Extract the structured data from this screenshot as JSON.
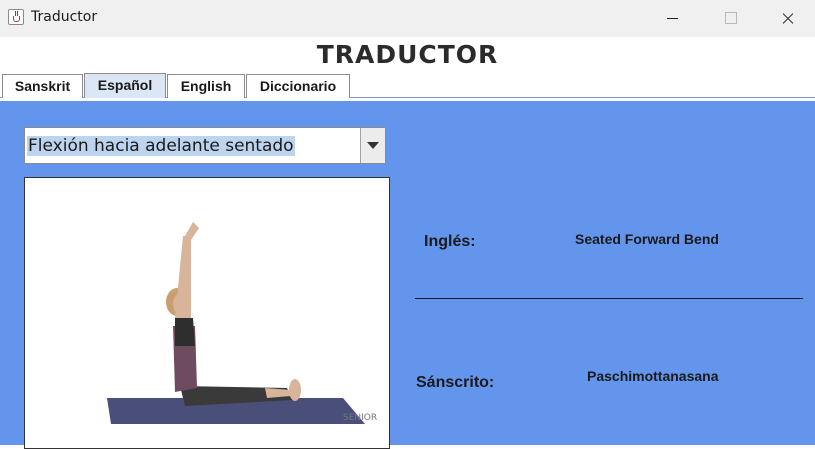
{
  "window": {
    "title": "Traductor",
    "app_icon": "java-cup-icon"
  },
  "header": {
    "title": "TRADUCTOR"
  },
  "tabs": [
    {
      "label": "Sanskrit",
      "active": false
    },
    {
      "label": "Español",
      "active": true
    },
    {
      "label": "English",
      "active": false
    },
    {
      "label": "Diccionario",
      "active": false
    }
  ],
  "main": {
    "combo": {
      "selected": "Flexión hacia adelante sentado"
    },
    "image": {
      "watermark": "SENIOR"
    },
    "fields": {
      "english_label": "Inglés:",
      "english_value": "Seated Forward Bend",
      "sanskrit_label": "Sánscrito:",
      "sanskrit_value": "Paschimottanasana"
    }
  },
  "colors": {
    "content_bg": "#6495ed",
    "active_tab": "#dbe7f5"
  }
}
